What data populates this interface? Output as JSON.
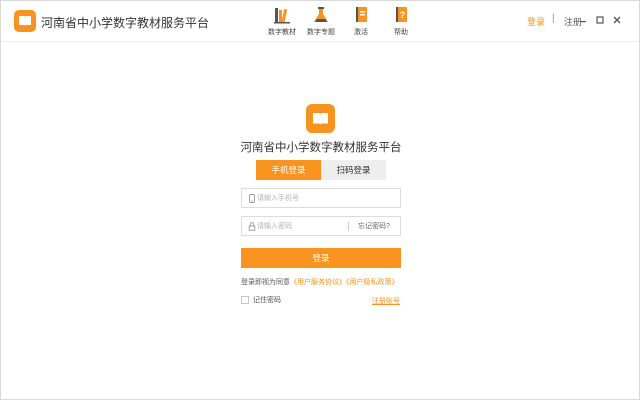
{
  "app": {
    "title": "河南省中小学数字教材服务平台"
  },
  "nav": {
    "items": [
      {
        "label": "数字教材",
        "icon": "bookshelf-icon"
      },
      {
        "label": "数字专题",
        "icon": "flask-icon"
      },
      {
        "label": "激活",
        "icon": "activate-book-icon"
      },
      {
        "label": "帮助",
        "icon": "help-book-icon"
      }
    ]
  },
  "header": {
    "login_label": "登录",
    "separator": "|",
    "register_label": "注册"
  },
  "window_controls": [
    "minimize-icon",
    "maximize-icon",
    "close-icon"
  ],
  "login": {
    "title": "河南省中小学数字教材服务平台",
    "tabs": [
      {
        "label": "手机登录",
        "active": true
      },
      {
        "label": "扫码登录",
        "active": false
      }
    ],
    "phone_placeholder": "请输入手机号",
    "phone_value": "",
    "password_placeholder": "请输入密码",
    "password_value": "",
    "forgot_label": "忘记密码?",
    "submit_label": "登录",
    "agreement_prefix": "登录即视为同意",
    "service_agreement": "《用户服务协议》",
    "privacy_policy": "《用户隐私政策》",
    "remember_label": "记住密码",
    "remember_checked": false,
    "register_label": "注册账号"
  },
  "colors": {
    "accent": "#f7931e",
    "tab_inactive_bg": "#eeeeee",
    "border": "#dcdcdc"
  }
}
